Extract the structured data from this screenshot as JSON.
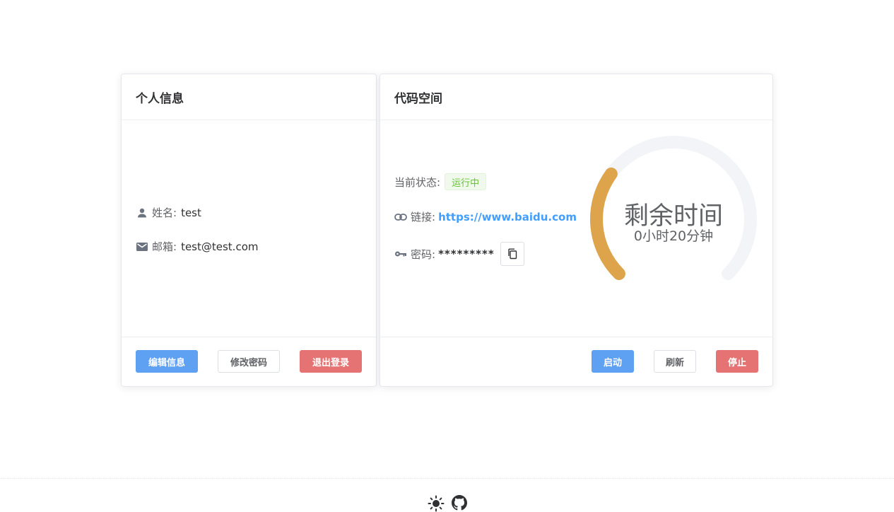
{
  "profile_card": {
    "title": "个人信息",
    "name_label": "姓名:",
    "name_value": "test",
    "email_label": "邮箱:",
    "email_value": "test@test.com",
    "buttons": {
      "edit": "编辑信息",
      "change_password": "修改密码",
      "logout": "退出登录"
    }
  },
  "codespace_card": {
    "title": "代码空间",
    "status_label": "当前状态:",
    "status_value": "运行中",
    "link_label": "链接:",
    "link_value": "https://www.baidu.com",
    "password_label": "密码:",
    "password_value": "*********",
    "gauge": {
      "title": "剩余时间",
      "value_text": "0小时20分钟",
      "fraction": 0.3
    },
    "buttons": {
      "start": "启动",
      "refresh": "刷新",
      "stop": "停止"
    }
  },
  "colors": {
    "primary": "#5ea0f2",
    "danger": "#e57373",
    "success": "#67c23a",
    "gauge": "#dda44b",
    "gauge_track": "#f2f4f8"
  },
  "footer": {
    "icons": [
      "sun-icon",
      "github-icon"
    ]
  }
}
